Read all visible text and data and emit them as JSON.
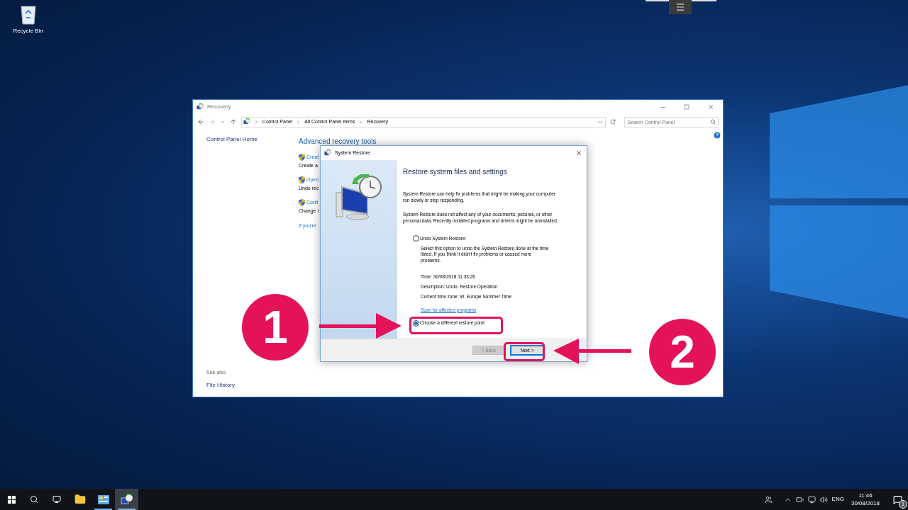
{
  "desktop": {
    "icons": [
      {
        "label": "Recycle Bin"
      }
    ]
  },
  "window": {
    "title": "Recovery",
    "breadcrumb": [
      "Control Panel",
      "All Control Panel Items",
      "Recovery"
    ],
    "search": {
      "placeholder": "Search Control Panel"
    },
    "sidebar": {
      "home_link": "Control Panel Home",
      "see_also": "See also",
      "links": [
        "File History"
      ]
    },
    "heading": "Advanced recovery tools",
    "items": [
      {
        "link": "Creat",
        "description": "Create a"
      },
      {
        "link": "Open",
        "description": "Undo rec"
      },
      {
        "link": "Confi",
        "description": "Change r"
      }
    ],
    "footer_link": "If you're"
  },
  "dialog": {
    "title": "System Restore",
    "heading": "Restore system files and settings",
    "paragraphs": [
      "System Restore can help fix problems that might be making your computer run slowly or stop responding.",
      "System Restore does not affect any of your documents, pictures, or other personal data. Recently installed programs and drivers might be uninstalled."
    ],
    "options": [
      {
        "label": "Undo System Restore:",
        "selected": false,
        "description": "Select this option to undo the System Restore done at the time listed, If you think it didn't fix problems or caused more problems.",
        "details": [
          "Time: 30/08/2018 11:33:26",
          "Description: Undo: Restore Operation",
          "Current time zone: W. Europe Summer Time"
        ],
        "link": "Scan for affected programs"
      },
      {
        "label": "Choose a different restore point",
        "selected": true
      }
    ],
    "buttons": [
      {
        "label": "< Back",
        "disabled": true,
        "highlighted": false
      },
      {
        "label": "Next >",
        "disabled": false,
        "highlighted": true
      }
    ]
  },
  "annotations": [
    {
      "label": "1"
    },
    {
      "label": "2"
    }
  ],
  "taskbar": {
    "apps": [
      {
        "kind": "folder",
        "running": false,
        "selected": false
      },
      {
        "kind": "control-panel",
        "running": true,
        "selected": false
      },
      {
        "kind": "restore",
        "running": true,
        "selected": true
      }
    ],
    "language": "ENG",
    "time": "11:46",
    "date": "30/08/2018",
    "notification_count": "1"
  }
}
